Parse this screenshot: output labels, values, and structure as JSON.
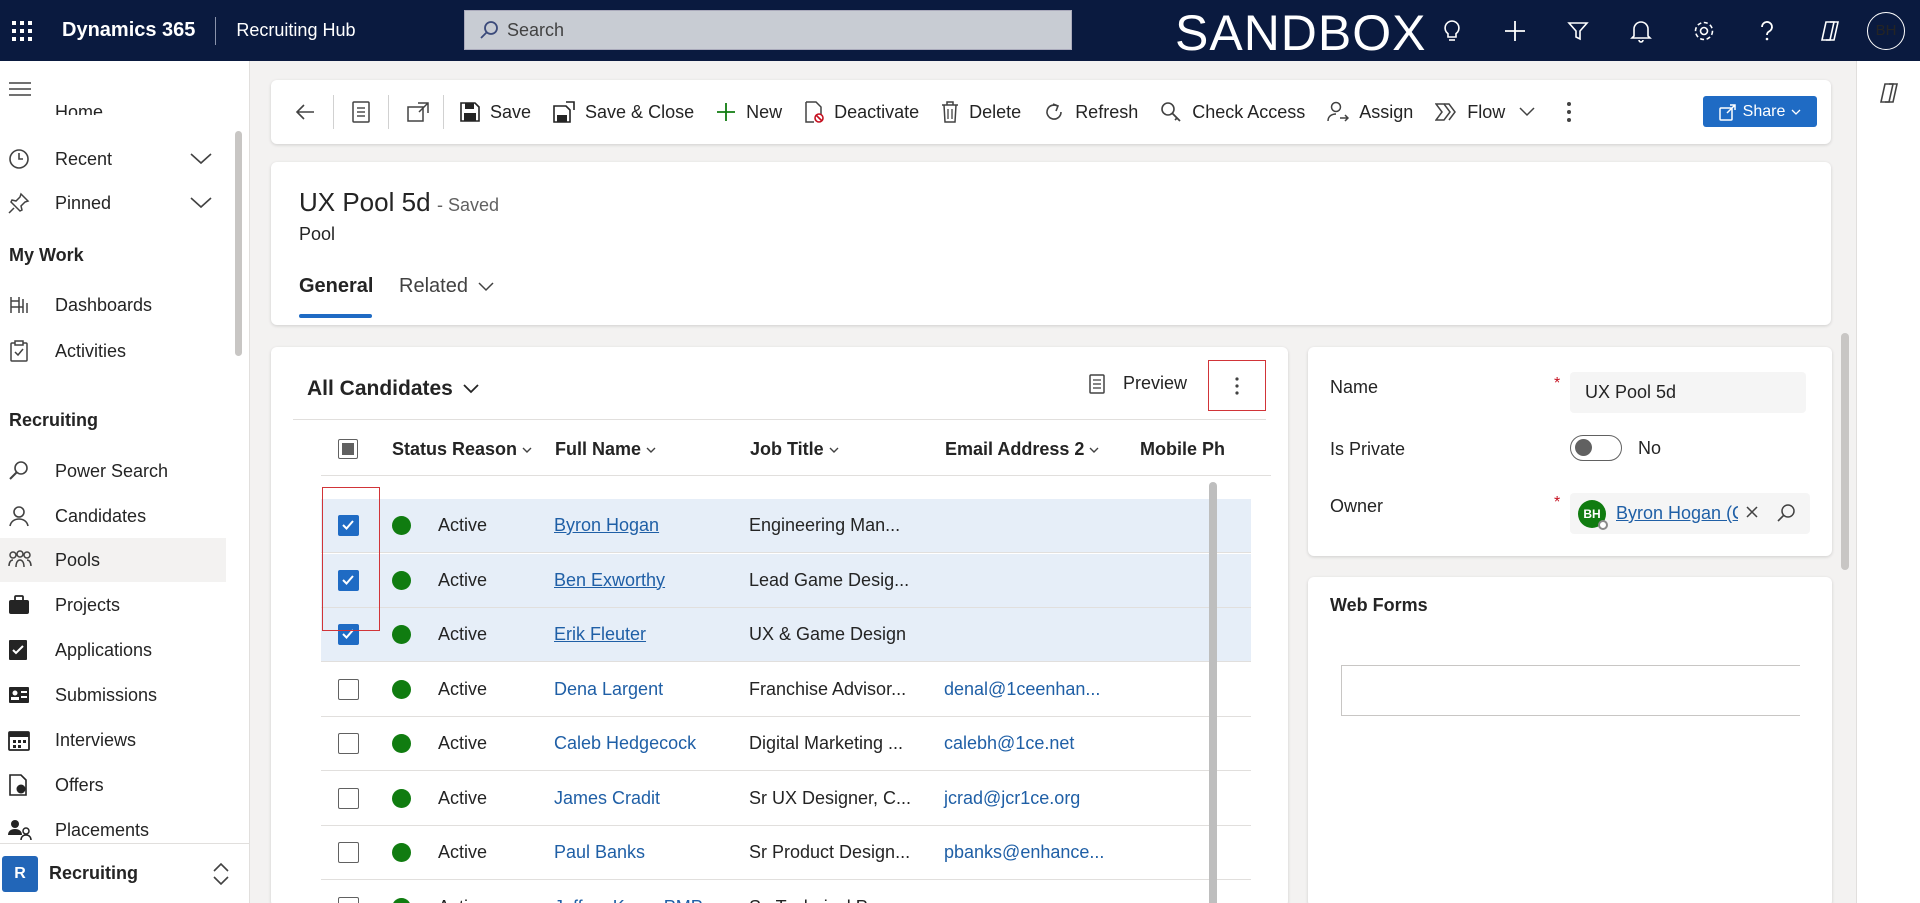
{
  "topbar": {
    "brand": "Dynamics 365",
    "app_name": "Recruiting Hub",
    "search_placeholder": "Search",
    "environment": "SANDBOX",
    "user_initials": "BH"
  },
  "leftnav": {
    "home_label": "Home",
    "recent_label": "Recent",
    "pinned_label": "Pinned",
    "my_work_heading": "My Work",
    "my_work_items": [
      "Dashboards",
      "Activities"
    ],
    "recruiting_heading": "Recruiting",
    "recruiting_items": [
      "Power Search",
      "Candidates",
      "Pools",
      "Projects",
      "Applications",
      "Submissions",
      "Interviews",
      "Offers",
      "Placements"
    ],
    "selected_item": "Pools",
    "area_badge": "R",
    "area_label": "Recruiting"
  },
  "commandbar": {
    "save": "Save",
    "save_close": "Save & Close",
    "new": "New",
    "deactivate": "Deactivate",
    "delete": "Delete",
    "refresh": "Refresh",
    "check_access": "Check Access",
    "assign": "Assign",
    "flow": "Flow",
    "share": "Share"
  },
  "record": {
    "title": "UX Pool 5d",
    "saved_status": "- Saved",
    "entity": "Pool",
    "tab_general": "General",
    "tab_related": "Related"
  },
  "grid": {
    "view_name": "All Candidates",
    "preview_label": "Preview",
    "columns": [
      "Status Reason",
      "Full Name",
      "Job Title",
      "Email Address 2",
      "Mobile Ph"
    ],
    "rows": [
      {
        "selected": true,
        "status": "Active",
        "name": "Byron Hogan",
        "job": "Engineering Man...",
        "email": ""
      },
      {
        "selected": true,
        "status": "Active",
        "name": "Ben Exworthy",
        "job": "Lead Game Desig...",
        "email": ""
      },
      {
        "selected": true,
        "status": "Active",
        "name": "Erik Fleuter",
        "job": "UX & Game Design",
        "email": ""
      },
      {
        "selected": false,
        "status": "Active",
        "name": "Dena Largent",
        "job": "Franchise Advisor...",
        "email": "denal@1ceenhan..."
      },
      {
        "selected": false,
        "status": "Active",
        "name": "Caleb Hedgecock",
        "job": "Digital Marketing ...",
        "email": "calebh@1ce.net"
      },
      {
        "selected": false,
        "status": "Active",
        "name": "James Cradit",
        "job": "Sr UX Designer, C...",
        "email": "jcrad@jcr1ce.org"
      },
      {
        "selected": false,
        "status": "Active",
        "name": "Paul Banks",
        "job": "Sr Product Design...",
        "email": "pbanks@enhance..."
      },
      {
        "selected": false,
        "status": "Active",
        "name": "Jeffrey Kunz, PMP",
        "job": "Sr. Technical Prog...",
        "email": ""
      }
    ]
  },
  "form": {
    "name_label": "Name",
    "name_value": "UX Pool 5d",
    "is_private_label": "Is Private",
    "is_private_value": "No",
    "owner_label": "Owner",
    "owner_initials": "BH",
    "owner_name": "Byron Hogan (C",
    "required_marker": "*"
  },
  "webforms": {
    "title": "Web Forms"
  },
  "colors": {
    "topbar_bg": "#0a1a3f",
    "accent": "#1f6bc4",
    "active_status": "#107c10",
    "highlight_border": "#d13438"
  }
}
